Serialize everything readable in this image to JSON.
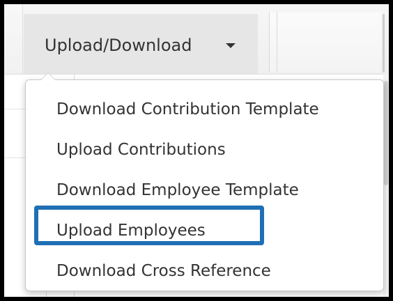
{
  "toolbar": {
    "dropdown_label": "Upload/Download"
  },
  "menu": {
    "items": [
      {
        "label": "Download Contribution Template"
      },
      {
        "label": "Upload Contributions"
      },
      {
        "label": "Download Employee Template"
      },
      {
        "label": "Upload Employees",
        "highlighted": true
      },
      {
        "label": "Download Cross Reference"
      }
    ]
  },
  "colors": {
    "highlight_border": "#1f6fb5",
    "button_background": "#e6e6e6",
    "text": "#333333"
  },
  "icons": {
    "dropdown_caret": "caret-down-icon"
  }
}
